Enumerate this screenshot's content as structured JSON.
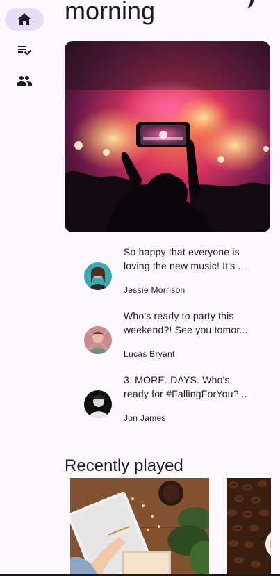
{
  "nav_rail": {
    "items": [
      {
        "label": "Home",
        "icon": "home-icon",
        "active": true
      },
      {
        "label": "Playlists",
        "icon": "playlist-icon",
        "active": false
      },
      {
        "label": "Friends",
        "icon": "people-icon",
        "active": false
      }
    ]
  },
  "header": {
    "greeting": "morning"
  },
  "feed": {
    "posts": [
      {
        "line1": "So happy that everyone is",
        "line2": "loving the new music! It's ...",
        "author": "Jessie Morrison"
      },
      {
        "line1": "Who's ready to party this",
        "line2": "weekend?! See you tomor...",
        "author": "Lucas Bryant"
      },
      {
        "line1": "3. MORE. DAYS. Who's",
        "line2": "ready for #FallingForYou?...",
        "author": "Jon James"
      }
    ]
  },
  "recently_played": {
    "title": "Recently played"
  },
  "colors": {
    "background": "#fdf7ff",
    "rail_active": "#e8def8",
    "on_surface": "#1d1b20"
  }
}
